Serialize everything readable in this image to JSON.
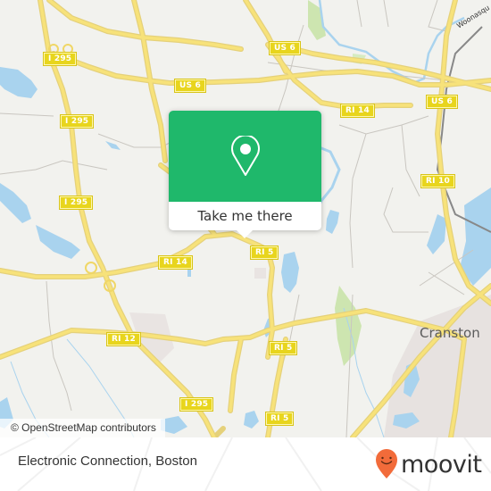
{
  "map": {
    "background_color": "#f2f2ee",
    "road_color": "#f7e27a",
    "water_color": "#a9d3ee",
    "park_color": "#cde5b0",
    "urban_color": "#e7e2e0",
    "shields": [
      {
        "label": "I 295",
        "type": "interstate"
      },
      {
        "label": "I 295",
        "type": "interstate"
      },
      {
        "label": "I 295",
        "type": "interstate"
      },
      {
        "label": "I 295",
        "type": "interstate"
      },
      {
        "label": "US 6",
        "type": "us-route"
      },
      {
        "label": "US 6",
        "type": "us-route"
      },
      {
        "label": "US 6",
        "type": "us-route"
      },
      {
        "label": "RI 14",
        "type": "state-route"
      },
      {
        "label": "RI 14",
        "type": "state-route"
      },
      {
        "label": "RI 10",
        "type": "state-route"
      },
      {
        "label": "RI 5",
        "type": "state-route"
      },
      {
        "label": "RI 5",
        "type": "state-route"
      },
      {
        "label": "RI 5",
        "type": "state-route"
      },
      {
        "label": "RI 12",
        "type": "state-route"
      }
    ],
    "city_label": "Cranston",
    "water_label": "Woonasqu",
    "attribution": "© OpenStreetMap contributors"
  },
  "popup": {
    "icon": "location-pin-icon",
    "accent_color": "#1fb86b",
    "button_label": "Take me there"
  },
  "footer": {
    "place_name": "Electronic Connection, Boston",
    "brand": {
      "name": "moovit",
      "logo_icon": "moovit-smiley-pin-icon",
      "logo_color": "#f26b3a"
    }
  }
}
